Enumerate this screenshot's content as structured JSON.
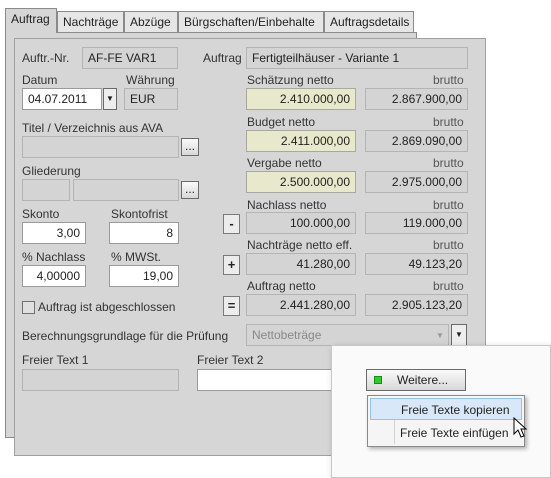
{
  "tabs": [
    "Auftrag",
    "Nachträge",
    "Abzüge",
    "Bürgschaften/Einbehalte",
    "Auftragsdetails"
  ],
  "left": {
    "auftr_nr_label": "Auftr.-Nr.",
    "auftr_nr_value": "AF-FE VAR1",
    "datum_label": "Datum",
    "datum_value": "04.07.2011",
    "waehrung_label": "Währung",
    "waehrung_value": "EUR",
    "titel_label": "Titel / Verzeichnis aus AVA",
    "gliederung_label": "Gliederung",
    "skonto_label": "Skonto",
    "skonto_value": "3,00",
    "skontofrist_label": "Skontofrist",
    "skontofrist_value": "8",
    "nachlass_label": "% Nachlass",
    "nachlass_value": "4,00000",
    "mwst_label": "% MWSt.",
    "mwst_value": "19,00",
    "abgeschlossen_label": "Auftrag ist abgeschlossen",
    "ellipsis": "..."
  },
  "right": {
    "auftrag_label": "Auftrag",
    "auftrag_value": "Fertigteilhäuser - Variante 1",
    "brutto_label": "brutto",
    "rows": [
      {
        "label": "Schätzung netto",
        "netto": "2.410.000,00",
        "brutto": "2.867.900,00"
      },
      {
        "label": "Budget netto",
        "netto": "2.411.000,00",
        "brutto": "2.869.090,00"
      },
      {
        "label": "Vergabe netto",
        "netto": "2.500.000,00",
        "brutto": "2.975.000,00"
      },
      {
        "label": "Nachlass netto",
        "netto": "100.000,00",
        "brutto": "119.000,00"
      },
      {
        "label": "Nachträge netto eff.",
        "netto": "41.280,00",
        "brutto": "49.123,20"
      },
      {
        "label": "Auftrag netto",
        "netto": "2.441.280,00",
        "brutto": "2.905.123,20"
      }
    ],
    "ops": [
      "-",
      "+",
      "="
    ]
  },
  "bottom": {
    "berechnung_label": "Berechnungsgrundlage für die Prüfung",
    "berechnung_value": "Nettobeträge",
    "freitext1_label": "Freier Text 1",
    "freitext2_label": "Freier Text 2"
  },
  "popup": {
    "weitere_label": "Weitere...",
    "menu": [
      "Freie Texte kopieren",
      "Freie Texte einfügen"
    ]
  },
  "colors": {
    "panel": "#d6d6d6",
    "highlight": "#e8e8cc",
    "led": "#2ecc2e"
  }
}
